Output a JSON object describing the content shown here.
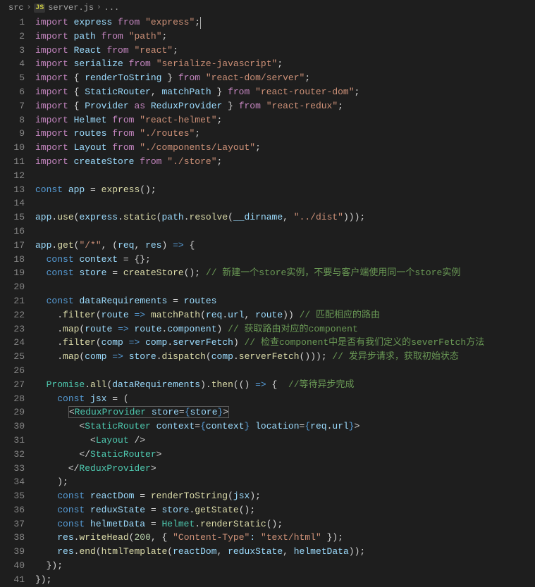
{
  "breadcrumb": {
    "folder": "src",
    "icon": "JS",
    "file": "server.js",
    "tail": "..."
  },
  "code": {
    "lines": [
      [
        [
          "c-kw",
          "import"
        ],
        [
          "c-op",
          " "
        ],
        [
          "c-var",
          "express"
        ],
        [
          "c-op",
          " "
        ],
        [
          "c-kw",
          "from"
        ],
        [
          "c-op",
          " "
        ],
        [
          "c-str",
          "\"express\""
        ],
        [
          "c-op",
          ";"
        ]
      ],
      [
        [
          "c-kw",
          "import"
        ],
        [
          "c-op",
          " "
        ],
        [
          "c-var",
          "path"
        ],
        [
          "c-op",
          " "
        ],
        [
          "c-kw",
          "from"
        ],
        [
          "c-op",
          " "
        ],
        [
          "c-str",
          "\"path\""
        ],
        [
          "c-op",
          ";"
        ]
      ],
      [
        [
          "c-kw",
          "import"
        ],
        [
          "c-op",
          " "
        ],
        [
          "c-var",
          "React"
        ],
        [
          "c-op",
          " "
        ],
        [
          "c-kw",
          "from"
        ],
        [
          "c-op",
          " "
        ],
        [
          "c-str",
          "\"react\""
        ],
        [
          "c-op",
          ";"
        ]
      ],
      [
        [
          "c-kw",
          "import"
        ],
        [
          "c-op",
          " "
        ],
        [
          "c-var",
          "serialize"
        ],
        [
          "c-op",
          " "
        ],
        [
          "c-kw",
          "from"
        ],
        [
          "c-op",
          " "
        ],
        [
          "c-str",
          "\"serialize-javascript\""
        ],
        [
          "c-op",
          ";"
        ]
      ],
      [
        [
          "c-kw",
          "import"
        ],
        [
          "c-op",
          " { "
        ],
        [
          "c-var",
          "renderToString"
        ],
        [
          "c-op",
          " } "
        ],
        [
          "c-kw",
          "from"
        ],
        [
          "c-op",
          " "
        ],
        [
          "c-str",
          "\"react-dom/server\""
        ],
        [
          "c-op",
          ";"
        ]
      ],
      [
        [
          "c-kw",
          "import"
        ],
        [
          "c-op",
          " { "
        ],
        [
          "c-var",
          "StaticRouter"
        ],
        [
          "c-op",
          ", "
        ],
        [
          "c-var",
          "matchPath"
        ],
        [
          "c-op",
          " } "
        ],
        [
          "c-kw",
          "from"
        ],
        [
          "c-op",
          " "
        ],
        [
          "c-str",
          "\"react-router-dom\""
        ],
        [
          "c-op",
          ";"
        ]
      ],
      [
        [
          "c-kw",
          "import"
        ],
        [
          "c-op",
          " { "
        ],
        [
          "c-var",
          "Provider"
        ],
        [
          "c-op",
          " "
        ],
        [
          "c-kw",
          "as"
        ],
        [
          "c-op",
          " "
        ],
        [
          "c-var",
          "ReduxProvider"
        ],
        [
          "c-op",
          " } "
        ],
        [
          "c-kw",
          "from"
        ],
        [
          "c-op",
          " "
        ],
        [
          "c-str",
          "\"react-redux\""
        ],
        [
          "c-op",
          ";"
        ]
      ],
      [
        [
          "c-kw",
          "import"
        ],
        [
          "c-op",
          " "
        ],
        [
          "c-var",
          "Helmet"
        ],
        [
          "c-op",
          " "
        ],
        [
          "c-kw",
          "from"
        ],
        [
          "c-op",
          " "
        ],
        [
          "c-str",
          "\"react-helmet\""
        ],
        [
          "c-op",
          ";"
        ]
      ],
      [
        [
          "c-kw",
          "import"
        ],
        [
          "c-op",
          " "
        ],
        [
          "c-var",
          "routes"
        ],
        [
          "c-op",
          " "
        ],
        [
          "c-kw",
          "from"
        ],
        [
          "c-op",
          " "
        ],
        [
          "c-str",
          "\"./routes\""
        ],
        [
          "c-op",
          ";"
        ]
      ],
      [
        [
          "c-kw",
          "import"
        ],
        [
          "c-op",
          " "
        ],
        [
          "c-var",
          "Layout"
        ],
        [
          "c-op",
          " "
        ],
        [
          "c-kw",
          "from"
        ],
        [
          "c-op",
          " "
        ],
        [
          "c-str",
          "\"./components/Layout\""
        ],
        [
          "c-op",
          ";"
        ]
      ],
      [
        [
          "c-kw",
          "import"
        ],
        [
          "c-op",
          " "
        ],
        [
          "c-var",
          "createStore"
        ],
        [
          "c-op",
          " "
        ],
        [
          "c-kw",
          "from"
        ],
        [
          "c-op",
          " "
        ],
        [
          "c-str",
          "\"./store\""
        ],
        [
          "c-op",
          ";"
        ]
      ],
      [],
      [
        [
          "c-const",
          "const"
        ],
        [
          "c-op",
          " "
        ],
        [
          "c-var",
          "app"
        ],
        [
          "c-op",
          " = "
        ],
        [
          "c-fn",
          "express"
        ],
        [
          "c-op",
          "();"
        ]
      ],
      [],
      [
        [
          "c-var",
          "app"
        ],
        [
          "c-op",
          "."
        ],
        [
          "c-fn",
          "use"
        ],
        [
          "c-op",
          "("
        ],
        [
          "c-var",
          "express"
        ],
        [
          "c-op",
          "."
        ],
        [
          "c-fn",
          "static"
        ],
        [
          "c-op",
          "("
        ],
        [
          "c-var",
          "path"
        ],
        [
          "c-op",
          "."
        ],
        [
          "c-fn",
          "resolve"
        ],
        [
          "c-op",
          "("
        ],
        [
          "c-var",
          "__dirname"
        ],
        [
          "c-op",
          ", "
        ],
        [
          "c-str",
          "\"../dist\""
        ],
        [
          "c-op",
          ")));"
        ]
      ],
      [],
      [
        [
          "c-var",
          "app"
        ],
        [
          "c-op",
          "."
        ],
        [
          "c-fn",
          "get"
        ],
        [
          "c-op",
          "("
        ],
        [
          "c-str",
          "\"/*\""
        ],
        [
          "c-op",
          ", ("
        ],
        [
          "c-var",
          "req"
        ],
        [
          "c-op",
          ", "
        ],
        [
          "c-var",
          "res"
        ],
        [
          "c-op",
          ") "
        ],
        [
          "c-const",
          "=>"
        ],
        [
          "c-op",
          " {"
        ]
      ],
      [
        [
          "c-op",
          "  "
        ],
        [
          "c-const",
          "const"
        ],
        [
          "c-op",
          " "
        ],
        [
          "c-var",
          "context"
        ],
        [
          "c-op",
          " = {};"
        ]
      ],
      [
        [
          "c-op",
          "  "
        ],
        [
          "c-const",
          "const"
        ],
        [
          "c-op",
          " "
        ],
        [
          "c-var",
          "store"
        ],
        [
          "c-op",
          " = "
        ],
        [
          "c-fn",
          "createStore"
        ],
        [
          "c-op",
          "(); "
        ],
        [
          "c-cmt",
          "// 新建一个store实例，不要与客户端使用同一个store实例"
        ]
      ],
      [],
      [
        [
          "c-op",
          "  "
        ],
        [
          "c-const",
          "const"
        ],
        [
          "c-op",
          " "
        ],
        [
          "c-var",
          "dataRequirements"
        ],
        [
          "c-op",
          " = "
        ],
        [
          "c-var",
          "routes"
        ]
      ],
      [
        [
          "c-op",
          "    ."
        ],
        [
          "c-fn",
          "filter"
        ],
        [
          "c-op",
          "("
        ],
        [
          "c-var",
          "route"
        ],
        [
          "c-op",
          " "
        ],
        [
          "c-const",
          "=>"
        ],
        [
          "c-op",
          " "
        ],
        [
          "c-fn",
          "matchPath"
        ],
        [
          "c-op",
          "("
        ],
        [
          "c-var",
          "req"
        ],
        [
          "c-op",
          "."
        ],
        [
          "c-var",
          "url"
        ],
        [
          "c-op",
          ", "
        ],
        [
          "c-var",
          "route"
        ],
        [
          "c-op",
          ")) "
        ],
        [
          "c-cmt",
          "// 匹配相应的路由"
        ]
      ],
      [
        [
          "c-op",
          "    ."
        ],
        [
          "c-fn",
          "map"
        ],
        [
          "c-op",
          "("
        ],
        [
          "c-var",
          "route"
        ],
        [
          "c-op",
          " "
        ],
        [
          "c-const",
          "=>"
        ],
        [
          "c-op",
          " "
        ],
        [
          "c-var",
          "route"
        ],
        [
          "c-op",
          "."
        ],
        [
          "c-var",
          "component"
        ],
        [
          "c-op",
          ") "
        ],
        [
          "c-cmt",
          "// 获取路由对应的component"
        ]
      ],
      [
        [
          "c-op",
          "    ."
        ],
        [
          "c-fn",
          "filter"
        ],
        [
          "c-op",
          "("
        ],
        [
          "c-var",
          "comp"
        ],
        [
          "c-op",
          " "
        ],
        [
          "c-const",
          "=>"
        ],
        [
          "c-op",
          " "
        ],
        [
          "c-var",
          "comp"
        ],
        [
          "c-op",
          "."
        ],
        [
          "c-var",
          "serverFetch"
        ],
        [
          "c-op",
          ") "
        ],
        [
          "c-cmt",
          "// 检查component中是否有我们定义的severFetch方法"
        ]
      ],
      [
        [
          "c-op",
          "    ."
        ],
        [
          "c-fn",
          "map"
        ],
        [
          "c-op",
          "("
        ],
        [
          "c-var",
          "comp"
        ],
        [
          "c-op",
          " "
        ],
        [
          "c-const",
          "=>"
        ],
        [
          "c-op",
          " "
        ],
        [
          "c-var",
          "store"
        ],
        [
          "c-op",
          "."
        ],
        [
          "c-fn",
          "dispatch"
        ],
        [
          "c-op",
          "("
        ],
        [
          "c-var",
          "comp"
        ],
        [
          "c-op",
          "."
        ],
        [
          "c-fn",
          "serverFetch"
        ],
        [
          "c-op",
          "())); "
        ],
        [
          "c-cmt",
          "// 发异步请求，获取初始状态"
        ]
      ],
      [],
      [
        [
          "c-op",
          "  "
        ],
        [
          "c-cls",
          "Promise"
        ],
        [
          "c-op",
          "."
        ],
        [
          "c-fn",
          "all"
        ],
        [
          "c-op",
          "("
        ],
        [
          "c-var",
          "dataRequirements"
        ],
        [
          "c-op",
          ")."
        ],
        [
          "c-fn",
          "then"
        ],
        [
          "c-op",
          "(() "
        ],
        [
          "c-const",
          "=>"
        ],
        [
          "c-op",
          " {  "
        ],
        [
          "c-cmt",
          "//等待异步完成"
        ]
      ],
      [
        [
          "c-op",
          "    "
        ],
        [
          "c-const",
          "const"
        ],
        [
          "c-op",
          " "
        ],
        [
          "c-var",
          "jsx"
        ],
        [
          "c-op",
          " = ("
        ]
      ],
      [
        [
          "c-op",
          "      "
        ],
        [
          "sel",
          [
            [
              "c-op",
              "<"
            ],
            [
              "c-cls",
              "ReduxProvider"
            ],
            [
              "c-op",
              " "
            ],
            [
              "c-var",
              "store"
            ],
            [
              "c-op",
              "="
            ],
            [
              "c-const",
              "{"
            ],
            [
              "c-var",
              "store"
            ],
            [
              "c-const",
              "}"
            ],
            [
              "c-op",
              ">"
            ]
          ]
        ]
      ],
      [
        [
          "c-op",
          "        <"
        ],
        [
          "c-cls",
          "StaticRouter"
        ],
        [
          "c-op",
          " "
        ],
        [
          "c-var",
          "context"
        ],
        [
          "c-op",
          "="
        ],
        [
          "c-const",
          "{"
        ],
        [
          "c-var",
          "context"
        ],
        [
          "c-const",
          "}"
        ],
        [
          "c-op",
          " "
        ],
        [
          "c-var",
          "location"
        ],
        [
          "c-op",
          "="
        ],
        [
          "c-const",
          "{"
        ],
        [
          "c-var",
          "req"
        ],
        [
          "c-op",
          "."
        ],
        [
          "c-var",
          "url"
        ],
        [
          "c-const",
          "}"
        ],
        [
          "c-op",
          ">"
        ]
      ],
      [
        [
          "c-op",
          "          <"
        ],
        [
          "c-cls",
          "Layout"
        ],
        [
          "c-op",
          " />"
        ]
      ],
      [
        [
          "c-op",
          "        </"
        ],
        [
          "c-cls",
          "StaticRouter"
        ],
        [
          "c-op",
          ">"
        ]
      ],
      [
        [
          "c-op",
          "      </"
        ],
        [
          "c-cls",
          "ReduxProvider"
        ],
        [
          "c-op",
          ">"
        ]
      ],
      [
        [
          "c-op",
          "    );"
        ]
      ],
      [
        [
          "c-op",
          "    "
        ],
        [
          "c-const",
          "const"
        ],
        [
          "c-op",
          " "
        ],
        [
          "c-var",
          "reactDom"
        ],
        [
          "c-op",
          " = "
        ],
        [
          "c-fn",
          "renderToString"
        ],
        [
          "c-op",
          "("
        ],
        [
          "c-var",
          "jsx"
        ],
        [
          "c-op",
          ");"
        ]
      ],
      [
        [
          "c-op",
          "    "
        ],
        [
          "c-const",
          "const"
        ],
        [
          "c-op",
          " "
        ],
        [
          "c-var",
          "reduxState"
        ],
        [
          "c-op",
          " = "
        ],
        [
          "c-var",
          "store"
        ],
        [
          "c-op",
          "."
        ],
        [
          "c-fn",
          "getState"
        ],
        [
          "c-op",
          "();"
        ]
      ],
      [
        [
          "c-op",
          "    "
        ],
        [
          "c-const",
          "const"
        ],
        [
          "c-op",
          " "
        ],
        [
          "c-var",
          "helmetData"
        ],
        [
          "c-op",
          " = "
        ],
        [
          "c-cls",
          "Helmet"
        ],
        [
          "c-op",
          "."
        ],
        [
          "c-fn",
          "renderStatic"
        ],
        [
          "c-op",
          "();"
        ]
      ],
      [
        [
          "c-op",
          "    "
        ],
        [
          "c-var",
          "res"
        ],
        [
          "c-op",
          "."
        ],
        [
          "c-fn",
          "writeHead"
        ],
        [
          "c-op",
          "("
        ],
        [
          "c-num",
          "200"
        ],
        [
          "c-op",
          ", { "
        ],
        [
          "c-str",
          "\"Content-Type\""
        ],
        [
          "c-var",
          ":"
        ],
        [
          "c-op",
          " "
        ],
        [
          "c-str",
          "\"text/html\""
        ],
        [
          "c-op",
          " });"
        ]
      ],
      [
        [
          "c-op",
          "    "
        ],
        [
          "c-var",
          "res"
        ],
        [
          "c-op",
          "."
        ],
        [
          "c-fn",
          "end"
        ],
        [
          "c-op",
          "("
        ],
        [
          "c-fn",
          "htmlTemplate"
        ],
        [
          "c-op",
          "("
        ],
        [
          "c-var",
          "reactDom"
        ],
        [
          "c-op",
          ", "
        ],
        [
          "c-var",
          "reduxState"
        ],
        [
          "c-op",
          ", "
        ],
        [
          "c-var",
          "helmetData"
        ],
        [
          "c-op",
          "));"
        ]
      ],
      [
        [
          "c-op",
          "  });"
        ]
      ],
      [
        [
          "c-op",
          "});"
        ]
      ]
    ]
  }
}
